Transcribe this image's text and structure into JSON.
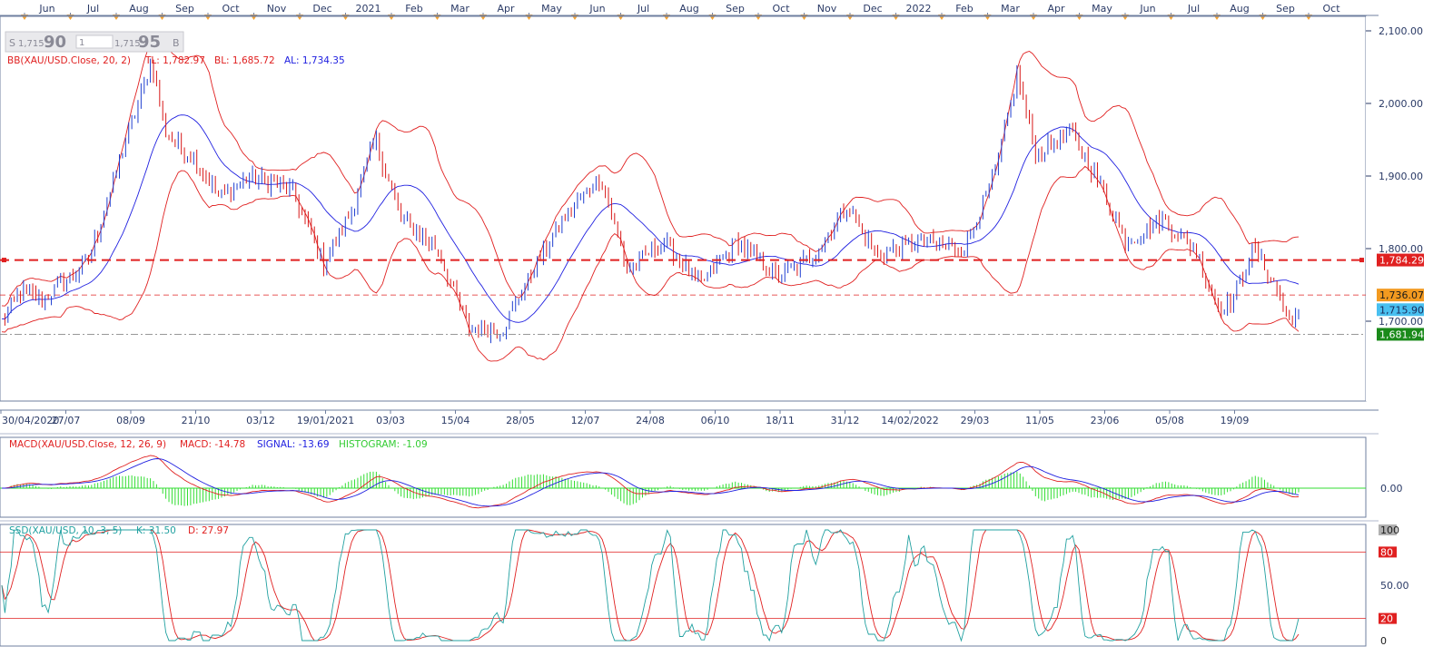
{
  "window": {
    "title": "XAU/USD Daily"
  },
  "quote_box": {
    "sell_label": "S",
    "sell_small": "1,715",
    "sell_big": "90",
    "qty": "1",
    "buy_small": "1,715",
    "buy_big": "95",
    "buy_label": "B"
  },
  "top_axis": {
    "months": [
      "Jun",
      "Jul",
      "Aug",
      "Sep",
      "Oct",
      "Nov",
      "Dec",
      "2021",
      "Feb",
      "Mar",
      "Apr",
      "May",
      "Jun",
      "Jul",
      "Aug",
      "Sep",
      "Oct",
      "Nov",
      "Dec",
      "2022",
      "Feb",
      "Mar",
      "Apr",
      "May",
      "Jun",
      "Jul",
      "Aug",
      "Sep",
      "Oct"
    ]
  },
  "bottom_axis": {
    "dates": [
      "30/04/2020",
      "27/07",
      "08/09",
      "21/10",
      "03/12",
      "19/01/2021",
      "03/03",
      "15/04",
      "28/05",
      "12/07",
      "24/08",
      "06/10",
      "18/11",
      "31/12",
      "14/02/2022",
      "29/03",
      "11/05",
      "23/06",
      "05/08",
      "19/09"
    ]
  },
  "colors": {
    "bg": "#ffffff",
    "axis": "#2a3a66",
    "grid_frame": "#6f7f9f",
    "up_candle": "#1f3fd0",
    "down_candle": "#d81818",
    "bb": "#e02020",
    "al": "#2020e0",
    "macd": "#e02020",
    "signal": "#2020e0",
    "histogram": "#33dd33",
    "ssd_k": "#20a0a0",
    "ssd_d": "#e02020",
    "marker_red": "#e02020",
    "marker_orange": "#f39a20",
    "marker_blue": "#49c0f0",
    "marker_green": "#1a8a1a"
  },
  "main_panel": {
    "indicator_name": "BB(XAU/USD.Close, 20, 2)",
    "tl_label": "TL: 1,782.97",
    "bl_label": "BL: 1,685.72",
    "al_label": "AL: 1,734.35",
    "y_ticks": [
      "2,100.00",
      "2,000.00",
      "1,900.00",
      "1,800.00",
      "1,700.00"
    ],
    "y_tick_values": [
      2100,
      2000,
      1900,
      1800,
      1700
    ],
    "ylim": [
      1590,
      2120
    ],
    "markers": [
      {
        "label": "1,784.29",
        "value": 1784.29,
        "color": "#e02020"
      },
      {
        "label": "1,736.07",
        "value": 1736.07,
        "color": "#f39a20"
      },
      {
        "label": "1,715.90",
        "value": 1715.9,
        "color": "#49c0f0"
      },
      {
        "label": "1,681.94",
        "value": 1681.94,
        "color": "#1a8a1a"
      }
    ]
  },
  "macd_panel": {
    "label_name": "MACD(XAU/USD.Close, 12, 26, 9)",
    "label_macd": "MACD: -14.78",
    "label_signal": "SIGNAL: -13.69",
    "label_hist": "HISTOGRAM: -1.09",
    "zero_label": "0.00"
  },
  "ssd_panel": {
    "label_name": "SSD(XAU/USD, 10, 3, 5)",
    "label_k": "K: 31.50",
    "label_d": "D: 27.97",
    "y_ticks": [
      "100",
      "80",
      "50.00",
      "20",
      "0"
    ]
  },
  "chart_data": {
    "type": "line",
    "symbol": "XAU/USD",
    "price_anchor_points": [
      {
        "t": 0,
        "v": 1700
      },
      {
        "t": 20,
        "v": 1740
      },
      {
        "t": 45,
        "v": 1730
      },
      {
        "t": 95,
        "v": 1780
      },
      {
        "t": 140,
        "v": 1960
      },
      {
        "t": 165,
        "v": 2060
      },
      {
        "t": 180,
        "v": 1960
      },
      {
        "t": 215,
        "v": 1920
      },
      {
        "t": 240,
        "v": 1870
      },
      {
        "t": 275,
        "v": 1900
      },
      {
        "t": 320,
        "v": 1880
      },
      {
        "t": 355,
        "v": 1780
      },
      {
        "t": 385,
        "v": 1850
      },
      {
        "t": 412,
        "v": 1950
      },
      {
        "t": 440,
        "v": 1840
      },
      {
        "t": 480,
        "v": 1800
      },
      {
        "t": 515,
        "v": 1690
      },
      {
        "t": 552,
        "v": 1690
      },
      {
        "t": 590,
        "v": 1780
      },
      {
        "t": 625,
        "v": 1850
      },
      {
        "t": 660,
        "v": 1900
      },
      {
        "t": 690,
        "v": 1770
      },
      {
        "t": 730,
        "v": 1810
      },
      {
        "t": 770,
        "v": 1750
      },
      {
        "t": 810,
        "v": 1810
      },
      {
        "t": 855,
        "v": 1760
      },
      {
        "t": 895,
        "v": 1790
      },
      {
        "t": 932,
        "v": 1860
      },
      {
        "t": 965,
        "v": 1790
      },
      {
        "t": 1010,
        "v": 1810
      },
      {
        "t": 1060,
        "v": 1800
      },
      {
        "t": 1095,
        "v": 1900
      },
      {
        "t": 1120,
        "v": 2040
      },
      {
        "t": 1140,
        "v": 1930
      },
      {
        "t": 1180,
        "v": 1960
      },
      {
        "t": 1210,
        "v": 1890
      },
      {
        "t": 1240,
        "v": 1810
      },
      {
        "t": 1280,
        "v": 1840
      },
      {
        "t": 1315,
        "v": 1800
      },
      {
        "t": 1340,
        "v": 1720
      },
      {
        "t": 1358,
        "v": 1730
      },
      {
        "t": 1380,
        "v": 1800
      },
      {
        "t": 1400,
        "v": 1760
      },
      {
        "t": 1420,
        "v": 1700
      },
      {
        "t": 1430,
        "v": 1716
      }
    ],
    "bollinger": {
      "period": 20,
      "std": 2,
      "tl": 1782.97,
      "bl": 1685.72,
      "al": 1734.35
    },
    "horizontal_levels": [
      1784.29,
      1736.07,
      1715.9,
      1681.94
    ],
    "macd": {
      "macd": -14.78,
      "signal": -13.69,
      "histogram": -1.09
    },
    "stochastic": {
      "k": 31.5,
      "d": 27.97,
      "upper": 80,
      "lower": 20,
      "ylim": [
        0,
        100
      ]
    }
  }
}
